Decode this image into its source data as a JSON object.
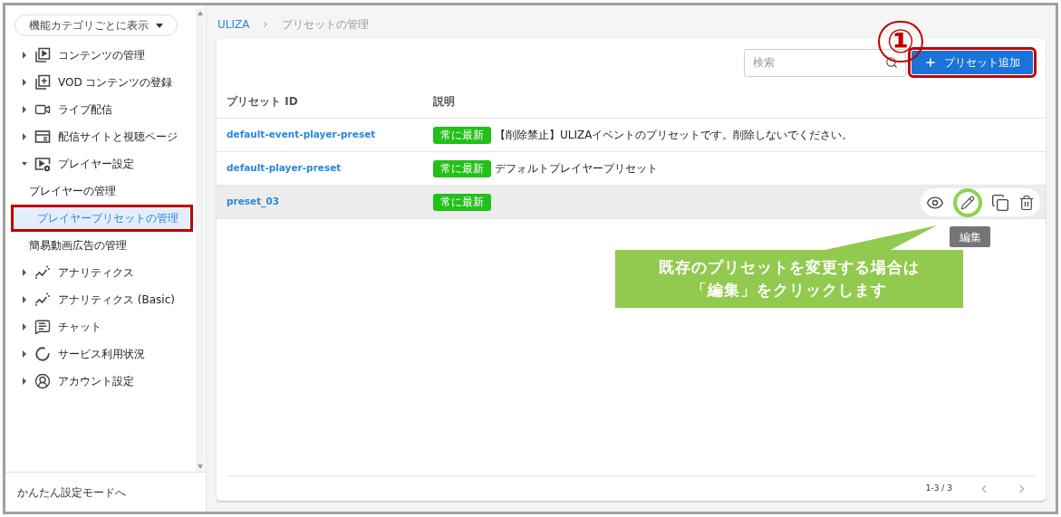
{
  "sidebar": {
    "view_toggle": "機能カテゴリごとに表示",
    "items": [
      {
        "label": "コンテンツの管理",
        "expanded": false
      },
      {
        "label": "VOD コンテンツの登録",
        "expanded": false
      },
      {
        "label": "ライブ配信",
        "expanded": false
      },
      {
        "label": "配信サイトと視聴ページ",
        "expanded": false
      },
      {
        "label": "プレイヤー設定",
        "expanded": true,
        "children": [
          {
            "label": "プレイヤーの管理",
            "selected": false,
            "highlighted": false
          },
          {
            "label": "プレイヤープリセットの管理",
            "selected": true,
            "highlighted": true
          },
          {
            "label": "簡易動画広告の管理",
            "selected": false,
            "highlighted": false
          }
        ]
      },
      {
        "label": "アナリティクス",
        "expanded": false
      },
      {
        "label": "アナリティクス (Basic)",
        "expanded": false
      },
      {
        "label": "チャット",
        "expanded": false
      },
      {
        "label": "サービス利用状況",
        "expanded": false
      },
      {
        "label": "アカウント設定",
        "expanded": false
      }
    ],
    "footer": "かんたん設定モードへ"
  },
  "breadcrumb": [
    "ULIZA",
    "プリセットの管理"
  ],
  "search": {
    "placeholder": "検索"
  },
  "add_button": {
    "label": "プリセット追加",
    "highlighted": true
  },
  "step_marker": "①",
  "table": {
    "columns": [
      "プリセット ID",
      "説明"
    ],
    "rows": [
      {
        "id": "default-event-player-preset",
        "badge": "常に最新",
        "description": "【削除禁止】ULIZAイベントのプリセットです。削除しないでください。",
        "hovered": false
      },
      {
        "id": "default-player-preset",
        "badge": "常に最新",
        "description": "デフォルトプレイヤープリセット",
        "hovered": false
      },
      {
        "id": "preset_03",
        "badge": "常に最新",
        "hovered": true
      }
    ]
  },
  "tooltip": "編集",
  "callout": [
    "既存のプリセットを変更する場合は",
    "「編集」をクリックします"
  ],
  "pagination": "1-3 / 3"
}
